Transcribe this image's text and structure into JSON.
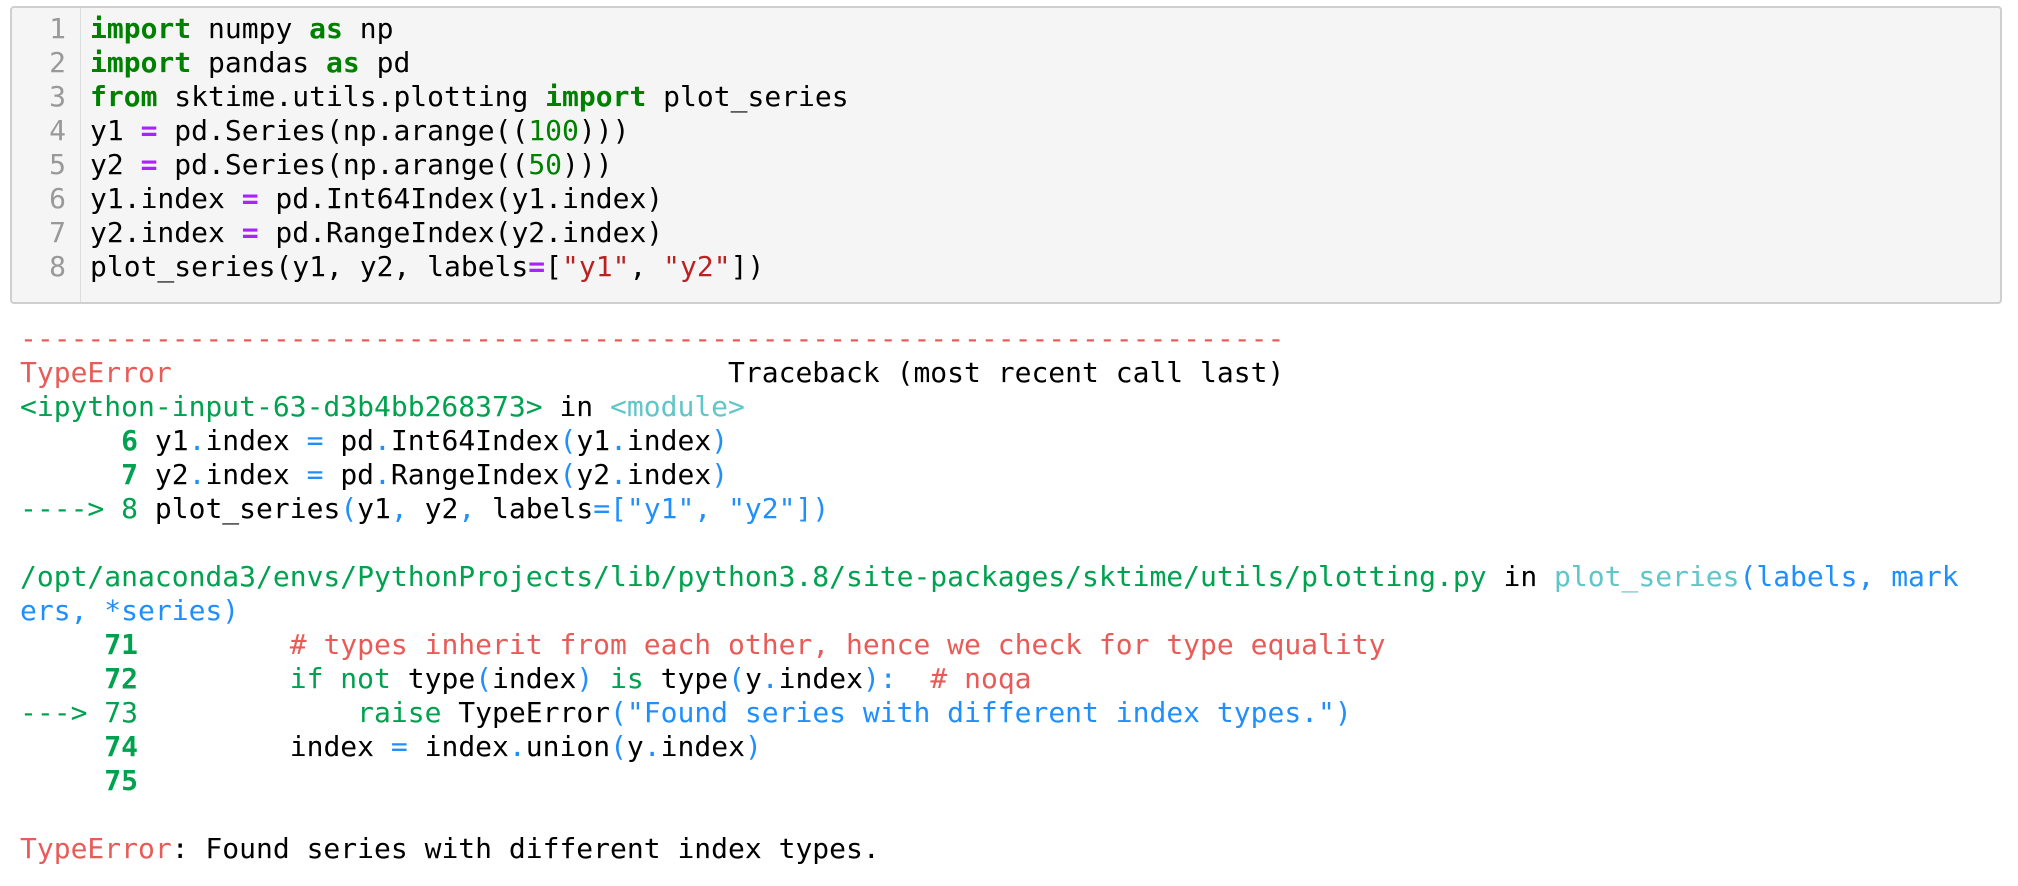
{
  "input_cell": {
    "line_numbers": [
      "1",
      "2",
      "3",
      "4",
      "5",
      "6",
      "7",
      "8"
    ],
    "lines": [
      {
        "tokens": [
          {
            "text": "import",
            "cls": "kw"
          },
          {
            "text": " numpy ",
            "cls": ""
          },
          {
            "text": "as",
            "cls": "kw"
          },
          {
            "text": " np",
            "cls": ""
          }
        ]
      },
      {
        "tokens": [
          {
            "text": "import",
            "cls": "kw"
          },
          {
            "text": " pandas ",
            "cls": ""
          },
          {
            "text": "as",
            "cls": "kw"
          },
          {
            "text": " pd",
            "cls": ""
          }
        ]
      },
      {
        "tokens": [
          {
            "text": "from",
            "cls": "kw"
          },
          {
            "text": " sktime.utils.plotting ",
            "cls": ""
          },
          {
            "text": "import",
            "cls": "kw"
          },
          {
            "text": " plot_series",
            "cls": ""
          }
        ]
      },
      {
        "tokens": [
          {
            "text": "y1 ",
            "cls": ""
          },
          {
            "text": "=",
            "cls": "op"
          },
          {
            "text": " pd.Series(np.arange((",
            "cls": ""
          },
          {
            "text": "100",
            "cls": "num"
          },
          {
            "text": ")))",
            "cls": ""
          }
        ]
      },
      {
        "tokens": [
          {
            "text": "y2 ",
            "cls": ""
          },
          {
            "text": "=",
            "cls": "op"
          },
          {
            "text": " pd.Series(np.arange((",
            "cls": ""
          },
          {
            "text": "50",
            "cls": "num"
          },
          {
            "text": ")))",
            "cls": ""
          }
        ]
      },
      {
        "tokens": [
          {
            "text": "y1.index ",
            "cls": ""
          },
          {
            "text": "=",
            "cls": "op"
          },
          {
            "text": " pd.Int64Index(y1.index)",
            "cls": ""
          }
        ]
      },
      {
        "tokens": [
          {
            "text": "y2.index ",
            "cls": ""
          },
          {
            "text": "=",
            "cls": "op"
          },
          {
            "text": " pd.RangeIndex(y2.index)",
            "cls": ""
          }
        ]
      },
      {
        "tokens": [
          {
            "text": "plot_series(y1, y2, labels",
            "cls": ""
          },
          {
            "text": "=",
            "cls": "op"
          },
          {
            "text": "[",
            "cls": ""
          },
          {
            "text": "\"y1\"",
            "cls": "str"
          },
          {
            "text": ", ",
            "cls": ""
          },
          {
            "text": "\"y2\"",
            "cls": "str"
          },
          {
            "text": "])",
            "cls": ""
          }
        ]
      }
    ]
  },
  "output": {
    "lines": [
      {
        "tokens": [
          {
            "text": "---------------------------------------------------------------------------",
            "cls": "t-red"
          }
        ]
      },
      {
        "tokens": [
          {
            "text": "TypeError",
            "cls": "t-red"
          },
          {
            "text": "                                 Traceback (most recent call last)",
            "cls": ""
          }
        ]
      },
      {
        "tokens": [
          {
            "text": "<ipython-input-63-d3b4bb268373>",
            "cls": "t-green"
          },
          {
            "text": " in ",
            "cls": ""
          },
          {
            "text": "<module>",
            "cls": "t-cyan"
          }
        ]
      },
      {
        "tokens": [
          {
            "text": "      6",
            "cls": "t-green-b"
          },
          {
            "text": " y1",
            "cls": ""
          },
          {
            "text": ".",
            "cls": "t-blue"
          },
          {
            "text": "index ",
            "cls": ""
          },
          {
            "text": "=",
            "cls": "t-blue"
          },
          {
            "text": " pd",
            "cls": ""
          },
          {
            "text": ".",
            "cls": "t-blue"
          },
          {
            "text": "Int64Index",
            "cls": ""
          },
          {
            "text": "(",
            "cls": "t-blue"
          },
          {
            "text": "y1",
            "cls": ""
          },
          {
            "text": ".",
            "cls": "t-blue"
          },
          {
            "text": "index",
            "cls": ""
          },
          {
            "text": ")",
            "cls": "t-blue"
          }
        ]
      },
      {
        "tokens": [
          {
            "text": "      7",
            "cls": "t-green-b"
          },
          {
            "text": " y2",
            "cls": ""
          },
          {
            "text": ".",
            "cls": "t-blue"
          },
          {
            "text": "index ",
            "cls": ""
          },
          {
            "text": "=",
            "cls": "t-blue"
          },
          {
            "text": " pd",
            "cls": ""
          },
          {
            "text": ".",
            "cls": "t-blue"
          },
          {
            "text": "RangeIndex",
            "cls": ""
          },
          {
            "text": "(",
            "cls": "t-blue"
          },
          {
            "text": "y2",
            "cls": ""
          },
          {
            "text": ".",
            "cls": "t-blue"
          },
          {
            "text": "index",
            "cls": ""
          },
          {
            "text": ")",
            "cls": "t-blue"
          }
        ]
      },
      {
        "tokens": [
          {
            "text": "----> 8",
            "cls": "t-green"
          },
          {
            "text": " plot_series",
            "cls": ""
          },
          {
            "text": "(",
            "cls": "t-blue"
          },
          {
            "text": "y1",
            "cls": ""
          },
          {
            "text": ",",
            "cls": "t-blue"
          },
          {
            "text": " y2",
            "cls": ""
          },
          {
            "text": ",",
            "cls": "t-blue"
          },
          {
            "text": " labels",
            "cls": ""
          },
          {
            "text": "=[\"y1\", \"y2\"])",
            "cls": "t-blue"
          }
        ]
      },
      {
        "tokens": [
          {
            "text": "",
            "cls": ""
          }
        ]
      },
      {
        "tokens": [
          {
            "text": "/opt/anaconda3/envs/PythonProjects/lib/python3.8/site-packages/sktime/utils/plotting.py",
            "cls": "t-green"
          },
          {
            "text": " in ",
            "cls": ""
          },
          {
            "text": "plot_series",
            "cls": "t-cyan"
          },
          {
            "text": "(labels, mark",
            "cls": "t-blue"
          }
        ]
      },
      {
        "tokens": [
          {
            "text": "ers, *series)",
            "cls": "t-blue"
          }
        ]
      },
      {
        "tokens": [
          {
            "text": "     71",
            "cls": "t-green-b"
          },
          {
            "text": "         # types inherit from each other, hence we check for type equality",
            "cls": "t-red"
          }
        ]
      },
      {
        "tokens": [
          {
            "text": "     72",
            "cls": "t-green-b"
          },
          {
            "text": "         if",
            "cls": "t-green"
          },
          {
            "text": " not",
            "cls": "t-green"
          },
          {
            "text": " type",
            "cls": ""
          },
          {
            "text": "(",
            "cls": "t-blue"
          },
          {
            "text": "index",
            "cls": ""
          },
          {
            "text": ")",
            "cls": "t-blue"
          },
          {
            "text": " is",
            "cls": "t-green"
          },
          {
            "text": " type",
            "cls": ""
          },
          {
            "text": "(",
            "cls": "t-blue"
          },
          {
            "text": "y",
            "cls": ""
          },
          {
            "text": ".",
            "cls": "t-blue"
          },
          {
            "text": "index",
            "cls": ""
          },
          {
            "text": "):",
            "cls": "t-blue"
          },
          {
            "text": "  # noqa",
            "cls": "t-red"
          }
        ]
      },
      {
        "tokens": [
          {
            "text": "---> 73",
            "cls": "t-green"
          },
          {
            "text": "             raise",
            "cls": "t-green"
          },
          {
            "text": " TypeError",
            "cls": ""
          },
          {
            "text": "(\"Found series with different index types.\")",
            "cls": "t-blue"
          }
        ]
      },
      {
        "tokens": [
          {
            "text": "     74",
            "cls": "t-green-b"
          },
          {
            "text": "         index ",
            "cls": ""
          },
          {
            "text": "=",
            "cls": "t-blue"
          },
          {
            "text": " index",
            "cls": ""
          },
          {
            "text": ".",
            "cls": "t-blue"
          },
          {
            "text": "union",
            "cls": ""
          },
          {
            "text": "(",
            "cls": "t-blue"
          },
          {
            "text": "y",
            "cls": ""
          },
          {
            "text": ".",
            "cls": "t-blue"
          },
          {
            "text": "index",
            "cls": ""
          },
          {
            "text": ")",
            "cls": "t-blue"
          }
        ]
      },
      {
        "tokens": [
          {
            "text": "     75",
            "cls": "t-green-b"
          }
        ]
      },
      {
        "tokens": [
          {
            "text": "",
            "cls": ""
          }
        ]
      },
      {
        "tokens": [
          {
            "text": "TypeError",
            "cls": "t-red"
          },
          {
            "text": ": Found series with different index types.",
            "cls": ""
          }
        ]
      }
    ]
  }
}
